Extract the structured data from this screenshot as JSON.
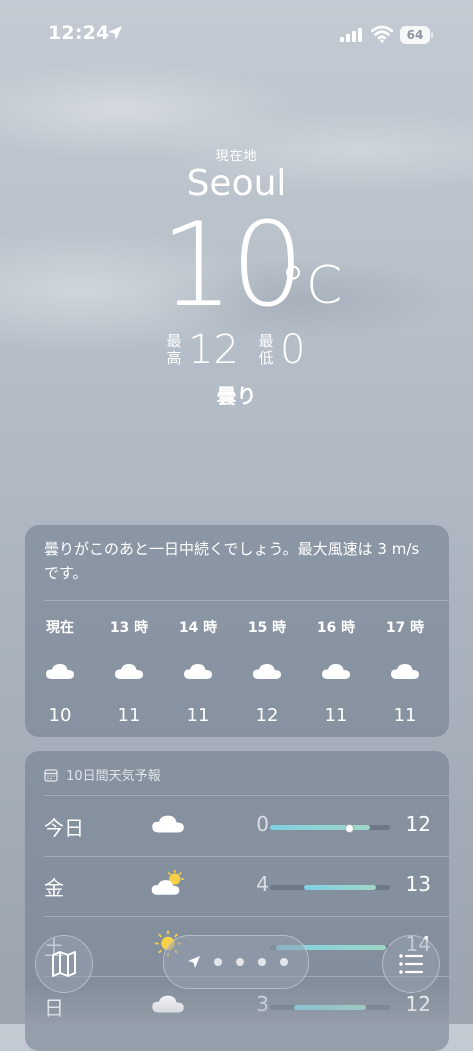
{
  "status_bar": {
    "time": "12:24",
    "battery": "64"
  },
  "location": {
    "label": "現在地",
    "city": "Seoul"
  },
  "current": {
    "temp": "10",
    "unit": "°C",
    "high_label": "最高",
    "high": "12",
    "low_label": "最低",
    "low": "0",
    "condition": "曇り"
  },
  "hourly": {
    "summary": "曇りがこのあと一日中続くでしょう。最大風速は 3 m/s です。",
    "items": [
      {
        "label": "現在",
        "icon": "cloud-icon",
        "temp": "10"
      },
      {
        "label": "13 時",
        "icon": "cloud-icon",
        "temp": "11"
      },
      {
        "label": "14 時",
        "icon": "cloud-icon",
        "temp": "11"
      },
      {
        "label": "15 時",
        "icon": "cloud-icon",
        "temp": "12"
      },
      {
        "label": "16 時",
        "icon": "cloud-icon",
        "temp": "11"
      },
      {
        "label": "17 時",
        "icon": "cloud-icon",
        "temp": "11"
      }
    ]
  },
  "daily": {
    "title": "10日間天気予報",
    "days": [
      {
        "name": "今日",
        "icon": "cloud-icon",
        "low": "0",
        "high": "12",
        "bar_start": 0.0,
        "bar_end": 0.83,
        "current_pos": 0.66
      },
      {
        "name": "金",
        "icon": "partly-sunny-icon",
        "low": "4",
        "high": "13",
        "bar_start": 0.28,
        "bar_end": 0.88
      },
      {
        "name": "土",
        "icon": "sun-icon",
        "low": "",
        "high": "14",
        "bar_start": 0.05,
        "bar_end": 0.97
      },
      {
        "name": "日",
        "icon": "cloud-icon",
        "low": "3",
        "high": "12",
        "bar_start": 0.2,
        "bar_end": 0.8
      }
    ]
  },
  "toolbar": {
    "map_icon": "map-icon",
    "location_icon": "location-arrow-icon",
    "list_icon": "list-icon",
    "pages": 4
  },
  "colors": {
    "bar_start": "#7fd1e4",
    "bar_end": "#9fd7c6",
    "card_bg": "rgba(112,124,140,0.55)"
  }
}
